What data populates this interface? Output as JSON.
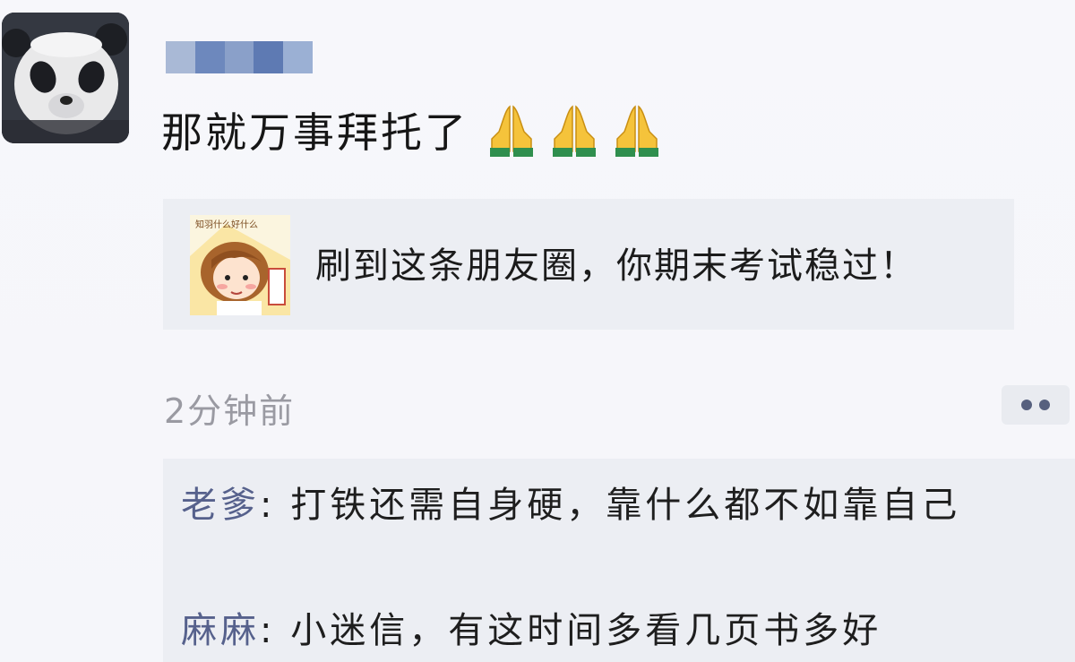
{
  "post": {
    "username_blurred": "",
    "text": "那就万事拜托了",
    "emojis": [
      "folded-hands",
      "folded-hands",
      "folded-hands"
    ]
  },
  "link": {
    "thumbnail_caption": "知羽什么好什么",
    "title": "刷到这条朋友圈，你期末考试稳过！"
  },
  "meta": {
    "timestamp": "2分钟前"
  },
  "comments": [
    {
      "author": "老爹",
      "separator": ": ",
      "text": "打铁还需自身硬，靠什么都不如靠自己"
    },
    {
      "author": "麻麻",
      "separator": ": ",
      "text": "小迷信，有这时间多看几页书多好"
    }
  ],
  "colors": {
    "author_link": "#56618c",
    "timestamp": "#9a9aa2",
    "card_bg": "#eceef3"
  }
}
